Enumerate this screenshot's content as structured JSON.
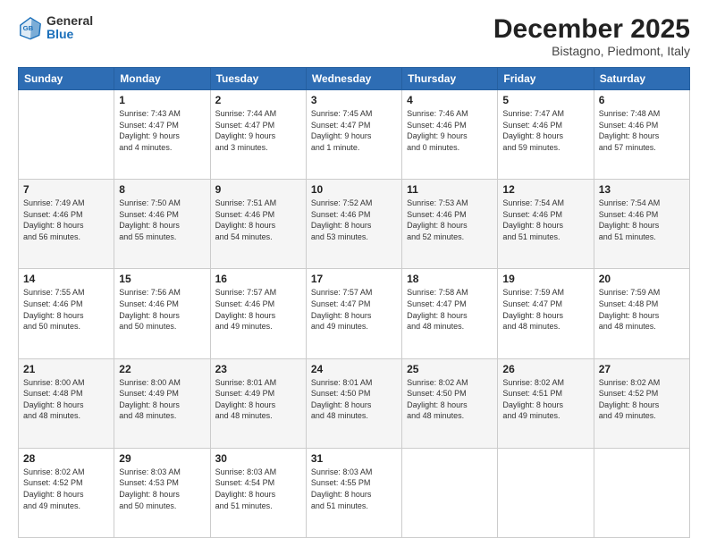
{
  "header": {
    "logo": {
      "general": "General",
      "blue": "Blue"
    },
    "title": "December 2025",
    "subtitle": "Bistagno, Piedmont, Italy"
  },
  "calendar": {
    "headers": [
      "Sunday",
      "Monday",
      "Tuesday",
      "Wednesday",
      "Thursday",
      "Friday",
      "Saturday"
    ],
    "rows": [
      [
        {
          "day": "",
          "info": ""
        },
        {
          "day": "1",
          "info": "Sunrise: 7:43 AM\nSunset: 4:47 PM\nDaylight: 9 hours\nand 4 minutes."
        },
        {
          "day": "2",
          "info": "Sunrise: 7:44 AM\nSunset: 4:47 PM\nDaylight: 9 hours\nand 3 minutes."
        },
        {
          "day": "3",
          "info": "Sunrise: 7:45 AM\nSunset: 4:47 PM\nDaylight: 9 hours\nand 1 minute."
        },
        {
          "day": "4",
          "info": "Sunrise: 7:46 AM\nSunset: 4:46 PM\nDaylight: 9 hours\nand 0 minutes."
        },
        {
          "day": "5",
          "info": "Sunrise: 7:47 AM\nSunset: 4:46 PM\nDaylight: 8 hours\nand 59 minutes."
        },
        {
          "day": "6",
          "info": "Sunrise: 7:48 AM\nSunset: 4:46 PM\nDaylight: 8 hours\nand 57 minutes."
        }
      ],
      [
        {
          "day": "7",
          "info": "Sunrise: 7:49 AM\nSunset: 4:46 PM\nDaylight: 8 hours\nand 56 minutes."
        },
        {
          "day": "8",
          "info": "Sunrise: 7:50 AM\nSunset: 4:46 PM\nDaylight: 8 hours\nand 55 minutes."
        },
        {
          "day": "9",
          "info": "Sunrise: 7:51 AM\nSunset: 4:46 PM\nDaylight: 8 hours\nand 54 minutes."
        },
        {
          "day": "10",
          "info": "Sunrise: 7:52 AM\nSunset: 4:46 PM\nDaylight: 8 hours\nand 53 minutes."
        },
        {
          "day": "11",
          "info": "Sunrise: 7:53 AM\nSunset: 4:46 PM\nDaylight: 8 hours\nand 52 minutes."
        },
        {
          "day": "12",
          "info": "Sunrise: 7:54 AM\nSunset: 4:46 PM\nDaylight: 8 hours\nand 51 minutes."
        },
        {
          "day": "13",
          "info": "Sunrise: 7:54 AM\nSunset: 4:46 PM\nDaylight: 8 hours\nand 51 minutes."
        }
      ],
      [
        {
          "day": "14",
          "info": "Sunrise: 7:55 AM\nSunset: 4:46 PM\nDaylight: 8 hours\nand 50 minutes."
        },
        {
          "day": "15",
          "info": "Sunrise: 7:56 AM\nSunset: 4:46 PM\nDaylight: 8 hours\nand 50 minutes."
        },
        {
          "day": "16",
          "info": "Sunrise: 7:57 AM\nSunset: 4:46 PM\nDaylight: 8 hours\nand 49 minutes."
        },
        {
          "day": "17",
          "info": "Sunrise: 7:57 AM\nSunset: 4:47 PM\nDaylight: 8 hours\nand 49 minutes."
        },
        {
          "day": "18",
          "info": "Sunrise: 7:58 AM\nSunset: 4:47 PM\nDaylight: 8 hours\nand 48 minutes."
        },
        {
          "day": "19",
          "info": "Sunrise: 7:59 AM\nSunset: 4:47 PM\nDaylight: 8 hours\nand 48 minutes."
        },
        {
          "day": "20",
          "info": "Sunrise: 7:59 AM\nSunset: 4:48 PM\nDaylight: 8 hours\nand 48 minutes."
        }
      ],
      [
        {
          "day": "21",
          "info": "Sunrise: 8:00 AM\nSunset: 4:48 PM\nDaylight: 8 hours\nand 48 minutes."
        },
        {
          "day": "22",
          "info": "Sunrise: 8:00 AM\nSunset: 4:49 PM\nDaylight: 8 hours\nand 48 minutes."
        },
        {
          "day": "23",
          "info": "Sunrise: 8:01 AM\nSunset: 4:49 PM\nDaylight: 8 hours\nand 48 minutes."
        },
        {
          "day": "24",
          "info": "Sunrise: 8:01 AM\nSunset: 4:50 PM\nDaylight: 8 hours\nand 48 minutes."
        },
        {
          "day": "25",
          "info": "Sunrise: 8:02 AM\nSunset: 4:50 PM\nDaylight: 8 hours\nand 48 minutes."
        },
        {
          "day": "26",
          "info": "Sunrise: 8:02 AM\nSunset: 4:51 PM\nDaylight: 8 hours\nand 49 minutes."
        },
        {
          "day": "27",
          "info": "Sunrise: 8:02 AM\nSunset: 4:52 PM\nDaylight: 8 hours\nand 49 minutes."
        }
      ],
      [
        {
          "day": "28",
          "info": "Sunrise: 8:02 AM\nSunset: 4:52 PM\nDaylight: 8 hours\nand 49 minutes."
        },
        {
          "day": "29",
          "info": "Sunrise: 8:03 AM\nSunset: 4:53 PM\nDaylight: 8 hours\nand 50 minutes."
        },
        {
          "day": "30",
          "info": "Sunrise: 8:03 AM\nSunset: 4:54 PM\nDaylight: 8 hours\nand 51 minutes."
        },
        {
          "day": "31",
          "info": "Sunrise: 8:03 AM\nSunset: 4:55 PM\nDaylight: 8 hours\nand 51 minutes."
        },
        {
          "day": "",
          "info": ""
        },
        {
          "day": "",
          "info": ""
        },
        {
          "day": "",
          "info": ""
        }
      ]
    ]
  }
}
